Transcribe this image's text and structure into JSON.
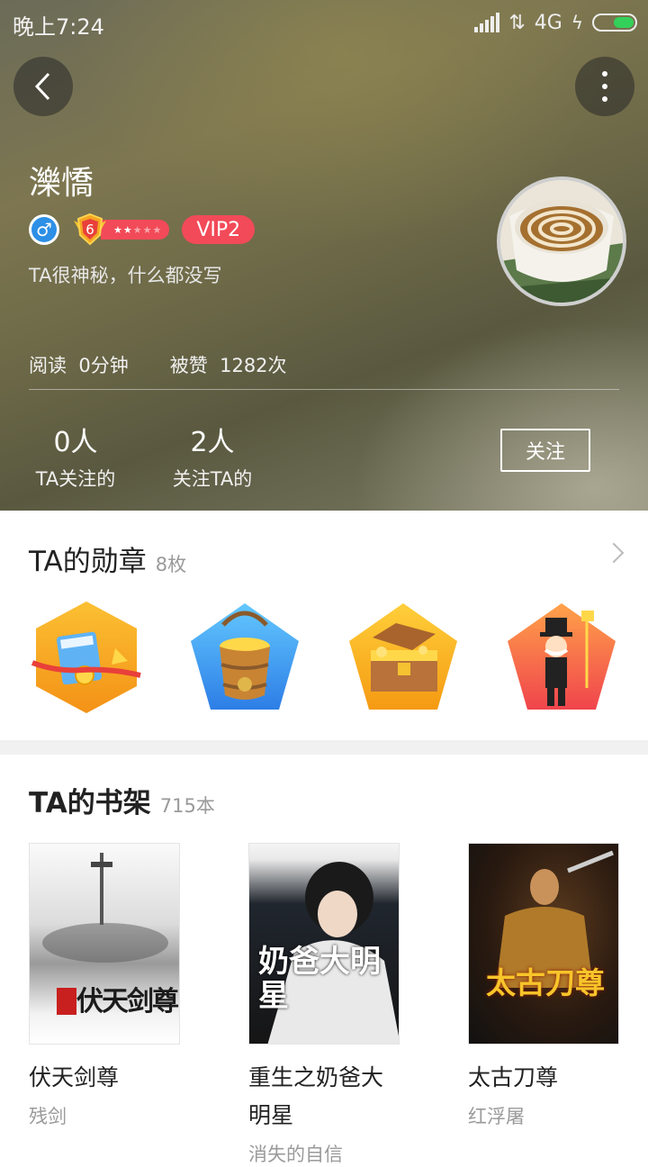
{
  "status_bar": {
    "time": "晚上7:24",
    "network": "4G"
  },
  "profile": {
    "name": "濼憍",
    "level": "6",
    "vip": "VIP2",
    "signature": "TA很神秘，什么都没写",
    "read_label": "阅读",
    "read_value": "0分钟",
    "likes_label": "被赞",
    "likes_value": "1282次",
    "following_count": "0人",
    "following_label": "TA关注的",
    "followers_count": "2人",
    "followers_label": "关注TA的",
    "follow_button": "关注"
  },
  "medals": {
    "title": "TA的勋章",
    "count": "8枚",
    "items": [
      "medal-check-in-icon",
      "medal-gold-bucket-icon",
      "medal-treasure-chest-icon",
      "medal-tycoon-icon"
    ]
  },
  "bookshelf": {
    "title": "TA的书架",
    "count": "715本",
    "books": [
      {
        "title": "伏天剑尊",
        "author": "残剑",
        "cover_text": "伏天剑尊"
      },
      {
        "title": "重生之奶爸大明星",
        "author": "消失的自信",
        "cover_text": "奶爸大明星"
      },
      {
        "title": "太古刀尊",
        "author": "红浮屠",
        "cover_text": "太古刀尊"
      }
    ]
  },
  "colors": {
    "vip": "#f24a58",
    "gender": "#2d8fe6",
    "battery": "#33d05a"
  }
}
